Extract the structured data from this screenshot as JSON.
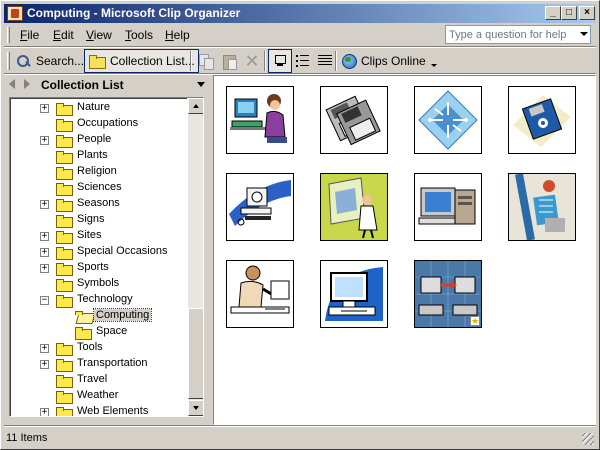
{
  "window": {
    "title": "Computing - Microsoft Clip Organizer",
    "minimize_glyph": "_",
    "maximize_glyph": "□",
    "close_glyph": "×"
  },
  "menu": {
    "items": [
      "File",
      "Edit",
      "View",
      "Tools",
      "Help"
    ],
    "accelerators": [
      "F",
      "E",
      "V",
      "T",
      "H"
    ],
    "help_placeholder": "Type a question for help"
  },
  "toolbar": {
    "search_label": "Search...",
    "collection_list_label": "Collection List...",
    "clips_online_label": "Clips Online",
    "delete_glyph": "✕",
    "icons": [
      "search-icon",
      "collection-folder-icon",
      "copy-icon",
      "paste-icon",
      "delete-icon",
      "thumbnails-view-icon",
      "list-view-icon",
      "details-view-icon",
      "globe-icon"
    ]
  },
  "taskpane": {
    "title": "Collection List",
    "tree": [
      {
        "label": "Nature",
        "level": 0,
        "expander": "+",
        "selected": false
      },
      {
        "label": "Occupations",
        "level": 0,
        "expander": "",
        "selected": false
      },
      {
        "label": "People",
        "level": 0,
        "expander": "+",
        "selected": false
      },
      {
        "label": "Plants",
        "level": 0,
        "expander": "",
        "selected": false
      },
      {
        "label": "Religion",
        "level": 0,
        "expander": "",
        "selected": false
      },
      {
        "label": "Sciences",
        "level": 0,
        "expander": "",
        "selected": false
      },
      {
        "label": "Seasons",
        "level": 0,
        "expander": "+",
        "selected": false
      },
      {
        "label": "Signs",
        "level": 0,
        "expander": "",
        "selected": false
      },
      {
        "label": "Sites",
        "level": 0,
        "expander": "+",
        "selected": false
      },
      {
        "label": "Special Occasions",
        "level": 0,
        "expander": "+",
        "selected": false
      },
      {
        "label": "Sports",
        "level": 0,
        "expander": "+",
        "selected": false
      },
      {
        "label": "Symbols",
        "level": 0,
        "expander": "",
        "selected": false
      },
      {
        "label": "Technology",
        "level": 0,
        "expander": "−",
        "selected": false
      },
      {
        "label": "Computing",
        "level": 1,
        "expander": "",
        "selected": true
      },
      {
        "label": "Space",
        "level": 1,
        "expander": "",
        "selected": false
      },
      {
        "label": "Tools",
        "level": 0,
        "expander": "+",
        "selected": false
      },
      {
        "label": "Transportation",
        "level": 0,
        "expander": "+",
        "selected": false
      },
      {
        "label": "Travel",
        "level": 0,
        "expander": "",
        "selected": false
      },
      {
        "label": "Weather",
        "level": 0,
        "expander": "",
        "selected": false
      },
      {
        "label": "Web Elements",
        "level": 0,
        "expander": "+",
        "selected": false
      }
    ]
  },
  "clips": [
    {
      "name": "woman-at-computer-clip"
    },
    {
      "name": "floppy-disks-clip"
    },
    {
      "name": "circuit-chip-clip"
    },
    {
      "name": "floppy-disk-blue-clip"
    },
    {
      "name": "computer-cd-clip"
    },
    {
      "name": "presenter-screen-clip"
    },
    {
      "name": "desktop-computer-clip"
    },
    {
      "name": "circuit-collage-clip"
    },
    {
      "name": "man-at-computer-clip"
    },
    {
      "name": "computer-monitor-clip"
    },
    {
      "name": "network-computers-clip",
      "badge": "star"
    }
  ],
  "status": {
    "text": "11 Items"
  },
  "colors": {
    "title_gradient_start": "#0a246a",
    "title_gradient_end": "#a6caf0",
    "window_face": "#d4d0c8",
    "folder_yellow": "#ffe84a"
  }
}
